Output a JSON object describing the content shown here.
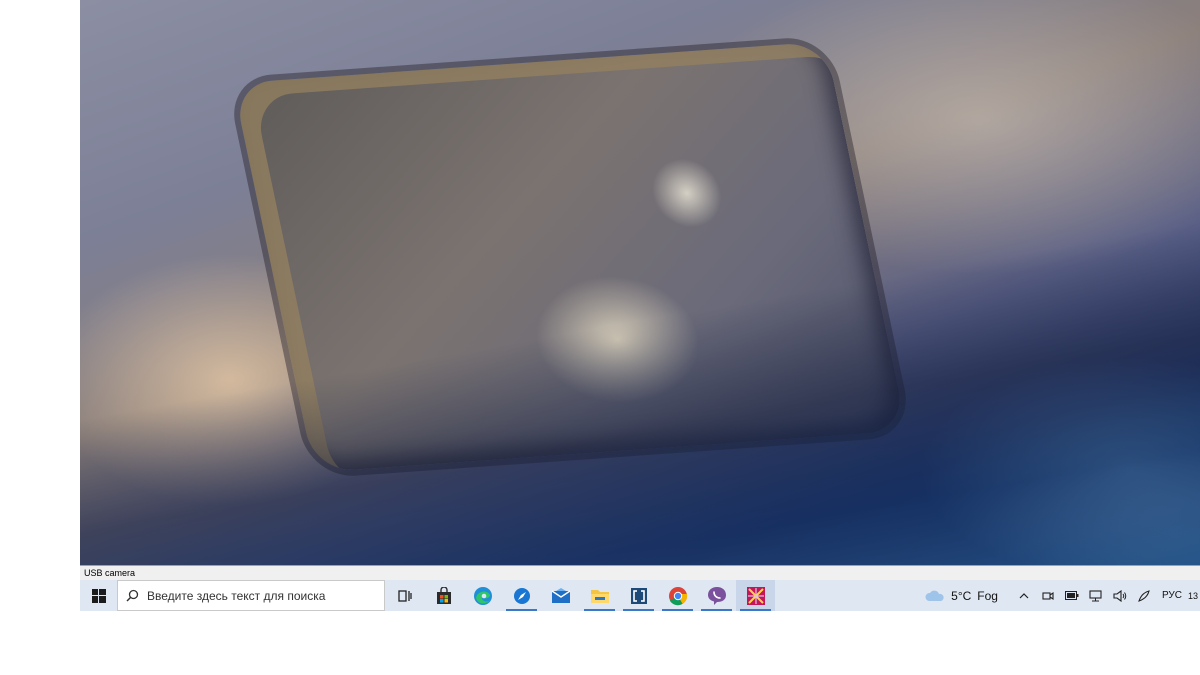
{
  "camera": {
    "window_label": "USB camera"
  },
  "taskbar": {
    "search_placeholder": "Введите здесь текст для поиска",
    "apps": [
      {
        "name": "task-view",
        "icon": "task-view-icon",
        "active": false
      },
      {
        "name": "microsoft-store",
        "icon": "store-bag-icon",
        "active": false
      },
      {
        "name": "edge",
        "icon": "edge-icon",
        "active": false
      },
      {
        "name": "app-blue-circle",
        "icon": "compass-icon",
        "active": true
      },
      {
        "name": "mail",
        "icon": "mail-icon",
        "active": false
      },
      {
        "name": "file-explorer",
        "icon": "folder-icon",
        "active": true
      },
      {
        "name": "app-square",
        "icon": "bracket-square-icon",
        "active": true
      },
      {
        "name": "chrome",
        "icon": "chrome-icon",
        "active": true
      },
      {
        "name": "viber",
        "icon": "viber-icon",
        "active": true
      },
      {
        "name": "camera-app",
        "icon": "camera-app-icon",
        "active": true,
        "focused": true
      }
    ],
    "weather": {
      "temp": "5°C",
      "condition": "Fog"
    },
    "language": "РУС",
    "clock": "13"
  },
  "colors": {
    "taskbar_bg": "#dfe7f2",
    "active_indicator": "#3a78c8"
  }
}
